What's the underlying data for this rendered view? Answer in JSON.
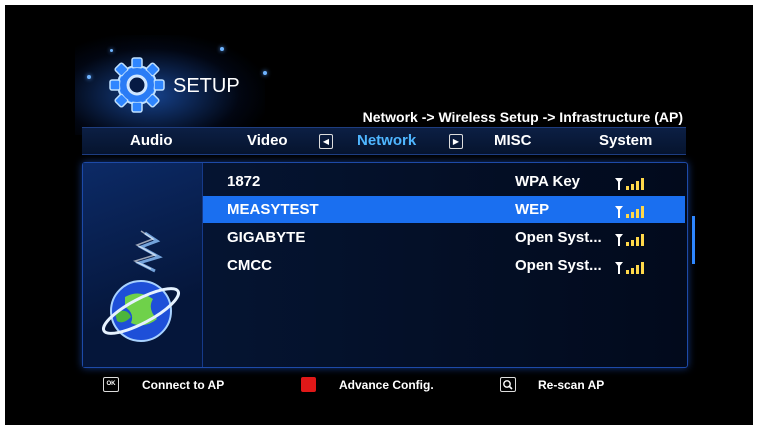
{
  "header": {
    "title": "SETUP",
    "breadcrumb": "Network -> Wireless Setup -> Infrastructure (AP)"
  },
  "tabs": [
    {
      "label": "Audio",
      "active": false
    },
    {
      "label": "Video",
      "active": false
    },
    {
      "label": "Network",
      "active": true
    },
    {
      "label": "MISC",
      "active": false
    },
    {
      "label": "System",
      "active": false
    }
  ],
  "tab_arrows": {
    "left_icon": "arrow-left-icon",
    "right_icon": "arrow-right-icon"
  },
  "access_points": [
    {
      "name": "1872",
      "security": "WPA Key",
      "selected": false
    },
    {
      "name": "MEASYTEST",
      "security": "WEP",
      "selected": true
    },
    {
      "name": "GIGABYTE",
      "security": "Open Syst...",
      "selected": false
    },
    {
      "name": "CMCC",
      "security": "Open Syst...",
      "selected": false
    }
  ],
  "footer": {
    "ok_key": "OK",
    "connect_label": "Connect to AP",
    "advance_label": "Advance Config.",
    "rescan_label": "Re-scan AP"
  },
  "colors": {
    "accent": "#4fb6ff",
    "selection": "#1a6ff0",
    "red_key": "#e01818",
    "signal": "#ffd84a"
  },
  "icons": [
    "gear-icon",
    "globe-icon",
    "signal-icon",
    "ok-key-icon",
    "red-key-icon",
    "rescan-icon"
  ]
}
